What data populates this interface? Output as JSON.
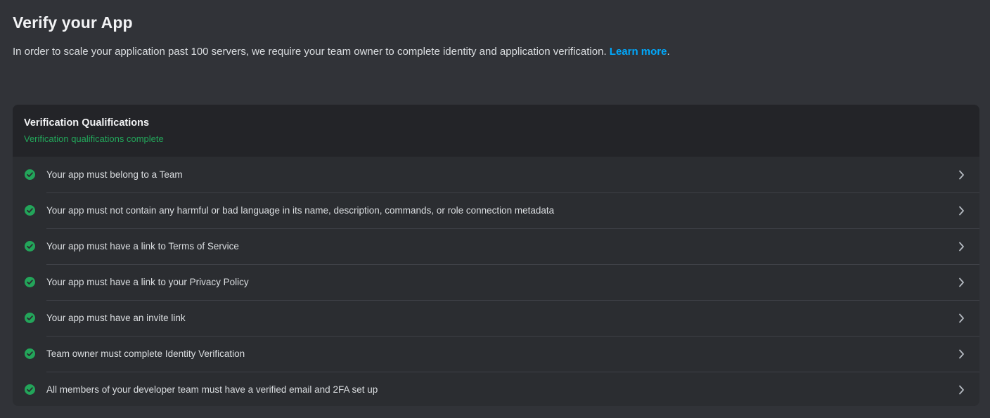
{
  "header": {
    "title": "Verify your App",
    "description": "In order to scale your application past 100 servers, we require your team owner to complete identity and application verification. ",
    "learn_more_label": "Learn more",
    "description_end": "."
  },
  "qualifications": {
    "title": "Verification Qualifications",
    "status": "Verification qualifications complete",
    "colors": {
      "complete": "#23a55a",
      "link": "#00a8fc"
    },
    "items": [
      {
        "label": "Your app must belong to a Team",
        "status_icon": "check-circle-icon"
      },
      {
        "label": "Your app must not contain any harmful or bad language in its name, description, commands, or role connection metadata",
        "status_icon": "check-circle-icon"
      },
      {
        "label": "Your app must have a link to Terms of Service",
        "status_icon": "check-circle-icon"
      },
      {
        "label": "Your app must have a link to your Privacy Policy",
        "status_icon": "check-circle-icon"
      },
      {
        "label": "Your app must have an invite link",
        "status_icon": "check-circle-icon"
      },
      {
        "label": "Team owner must complete Identity Verification",
        "status_icon": "check-circle-icon"
      },
      {
        "label": "All members of your developer team must have a verified email and 2FA set up",
        "status_icon": "check-circle-icon"
      }
    ]
  }
}
